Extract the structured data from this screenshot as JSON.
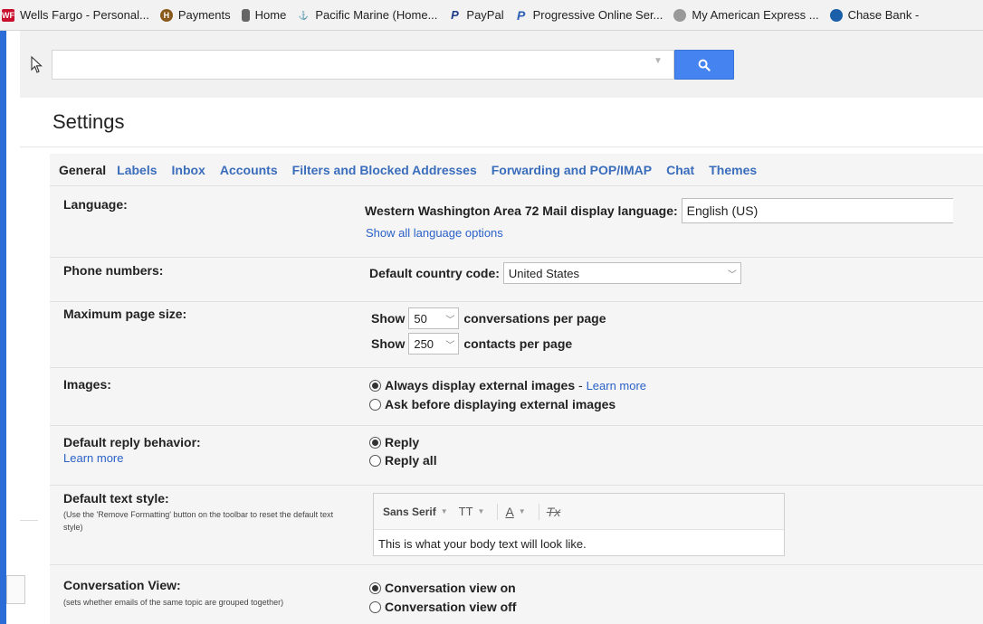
{
  "bookmarks": [
    {
      "label": "Wells Fargo - Personal...",
      "icon": "wells-fargo-icon",
      "color": "#c8102e"
    },
    {
      "label": "Payments",
      "icon": "harley-icon",
      "color": "#8a5a1c"
    },
    {
      "label": "Home",
      "icon": "phone-icon",
      "color": "#666666"
    },
    {
      "label": "Pacific Marine (Home...",
      "icon": "marine-icon",
      "color": "#9ab0c8"
    },
    {
      "label": "PayPal",
      "icon": "paypal-icon",
      "color": "#1f3c88"
    },
    {
      "label": "Progressive Online Ser...",
      "icon": "progressive-icon",
      "color": "#2b5fb4"
    },
    {
      "label": "My American Express ...",
      "icon": "globe-icon",
      "color": "#888888"
    },
    {
      "label": "Chase Bank -",
      "icon": "chase-icon",
      "color": "#1a5fa8"
    }
  ],
  "search": {
    "value": "",
    "placeholder": ""
  },
  "settings": {
    "title": "Settings",
    "tabs": [
      "General",
      "Labels",
      "Inbox",
      "Accounts",
      "Filters and Blocked Addresses",
      "Forwarding and POP/IMAP",
      "Chat",
      "Themes"
    ],
    "language": {
      "label": "Language:",
      "prompt": "Western Washington Area 72 Mail display language:",
      "value": "English (US)",
      "link": "Show all language options"
    },
    "phone": {
      "label": "Phone numbers:",
      "prompt": "Default country code:",
      "value": "United States"
    },
    "page_size": {
      "label": "Maximum page size:",
      "show": "Show",
      "conv_value": "50",
      "conv_suffix": "conversations per page",
      "contacts_value": "250",
      "contacts_suffix": "contacts per page"
    },
    "images": {
      "label": "Images:",
      "opt1": "Always display external images",
      "opt1_sep": " - ",
      "opt1_link": "Learn more",
      "opt2": "Ask before displaying external images",
      "selected": 1
    },
    "reply": {
      "label": "Default reply behavior:",
      "link": "Learn more",
      "opt1": "Reply",
      "opt2": "Reply all",
      "selected": 1
    },
    "text_style": {
      "label": "Default text style:",
      "note": "(Use the 'Remove Formatting' button on the toolbar to reset the default text style)",
      "font": "Sans Serif",
      "size_icon": "TT",
      "color_icon": "A",
      "clear_icon": "Tx",
      "preview": "This is what your body text will look like."
    },
    "conversation": {
      "label": "Conversation View:",
      "note": "(sets whether emails of the same topic are grouped together)",
      "opt1": "Conversation view on",
      "opt2": "Conversation view off",
      "selected": 1
    }
  },
  "colors": {
    "accent": "#4584f0",
    "link": "#2a61c7",
    "frame": "#2b6cd6"
  }
}
